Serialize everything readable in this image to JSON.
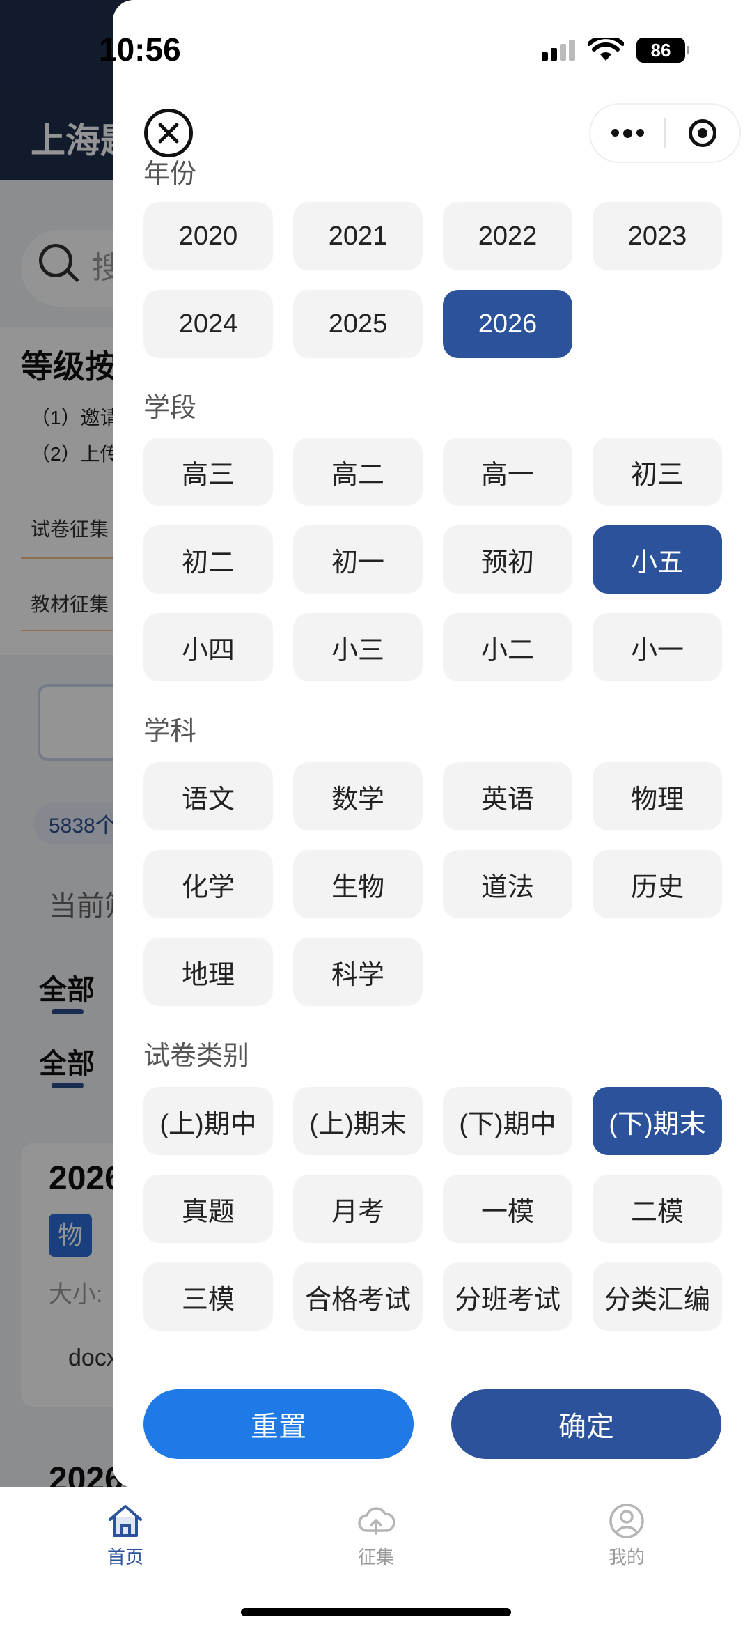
{
  "status_bar": {
    "time": "10:56",
    "battery": "86"
  },
  "background": {
    "title": "上海题",
    "search_placeholder": "搜",
    "heading": "等级按",
    "lines": [
      "（1）邀请",
      "（2）上传"
    ],
    "tag_exam": "试卷征集",
    "tag_textbook": "教材征集",
    "count_pill": "5838个",
    "current": "当前筛",
    "tab_all_1": "全部",
    "tab_all_2": "全部",
    "item_title": "2026",
    "item_badge": "物",
    "item_size": "大小:",
    "item_ext": "docx",
    "item2_title": "2026"
  },
  "filter": {
    "year": {
      "title": "年份",
      "options": [
        {
          "label": "2020",
          "selected": false
        },
        {
          "label": "2021",
          "selected": false
        },
        {
          "label": "2022",
          "selected": false
        },
        {
          "label": "2023",
          "selected": false
        },
        {
          "label": "2024",
          "selected": false
        },
        {
          "label": "2025",
          "selected": false
        },
        {
          "label": "2026",
          "selected": true
        }
      ]
    },
    "stage": {
      "title": "学段",
      "options": [
        {
          "label": "高三",
          "selected": false
        },
        {
          "label": "高二",
          "selected": false
        },
        {
          "label": "高一",
          "selected": false
        },
        {
          "label": "初三",
          "selected": false
        },
        {
          "label": "初二",
          "selected": false
        },
        {
          "label": "初一",
          "selected": false
        },
        {
          "label": "预初",
          "selected": false
        },
        {
          "label": "小五",
          "selected": true
        },
        {
          "label": "小四",
          "selected": false
        },
        {
          "label": "小三",
          "selected": false
        },
        {
          "label": "小二",
          "selected": false
        },
        {
          "label": "小一",
          "selected": false
        }
      ]
    },
    "subject": {
      "title": "学科",
      "options": [
        {
          "label": "语文",
          "selected": false
        },
        {
          "label": "数学",
          "selected": false
        },
        {
          "label": "英语",
          "selected": false
        },
        {
          "label": "物理",
          "selected": false
        },
        {
          "label": "化学",
          "selected": false
        },
        {
          "label": "生物",
          "selected": false
        },
        {
          "label": "道法",
          "selected": false
        },
        {
          "label": "历史",
          "selected": false
        },
        {
          "label": "地理",
          "selected": false
        },
        {
          "label": "科学",
          "selected": false
        }
      ]
    },
    "category": {
      "title": "试卷类别",
      "options": [
        {
          "label": "(上)期中",
          "selected": false
        },
        {
          "label": "(上)期末",
          "selected": false
        },
        {
          "label": "(下)期中",
          "selected": false
        },
        {
          "label": "(下)期末",
          "selected": true
        },
        {
          "label": "真题",
          "selected": false
        },
        {
          "label": "月考",
          "selected": false
        },
        {
          "label": "一模",
          "selected": false
        },
        {
          "label": "二模",
          "selected": false
        },
        {
          "label": "三模",
          "selected": false
        },
        {
          "label": "合格考试",
          "selected": false
        },
        {
          "label": "分班考试",
          "selected": false
        },
        {
          "label": "分类汇编",
          "selected": false
        }
      ]
    },
    "reset_label": "重置",
    "confirm_label": "确定"
  },
  "tabbar": {
    "home": "首页",
    "collect": "征集",
    "mine": "我的"
  },
  "colors": {
    "accent": "#2b529a",
    "reset": "#1f7ae8",
    "option_bg": "#f3f3f3",
    "header_bg": "#1f2f4d"
  },
  "icons": [
    "close-icon",
    "more-dots-icon",
    "target-icon",
    "home-icon",
    "cloud-upload-icon",
    "user-icon",
    "search-icon"
  ]
}
